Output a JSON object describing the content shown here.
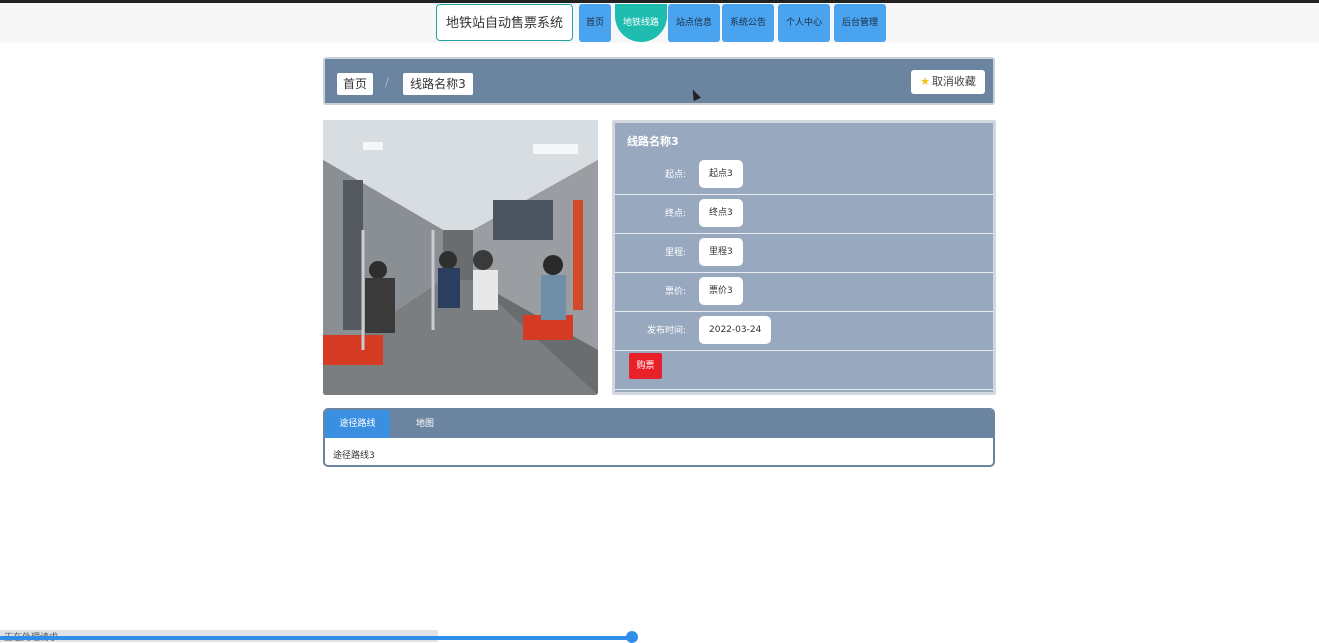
{
  "nav": {
    "brand": "地铁站自动售票系统",
    "items": [
      {
        "label": "首页"
      },
      {
        "label": "地铁线路"
      },
      {
        "label": "站点信息"
      },
      {
        "label": "系统公告"
      },
      {
        "label": "个人中心"
      },
      {
        "label": "后台管理"
      }
    ],
    "active_index": 1
  },
  "breadcrumb": {
    "home": "首页",
    "separator": "/",
    "current": "线路名称3",
    "favorite_button": "取消收藏"
  },
  "detail": {
    "title": "线路名称3",
    "fields": [
      {
        "label": "起点:",
        "value": "起点3"
      },
      {
        "label": "终点:",
        "value": "终点3"
      },
      {
        "label": "里程:",
        "value": "里程3"
      },
      {
        "label": "票价:",
        "value": "票价3"
      },
      {
        "label": "发布时间:",
        "value": "2022-03-24"
      }
    ],
    "buy_button": "购票"
  },
  "tabs": {
    "items": [
      {
        "label": "途径路线"
      },
      {
        "label": "地图"
      }
    ],
    "active_index": 0,
    "content": "途径路线3"
  },
  "status": {
    "text": "正在处理请求"
  },
  "colors": {
    "nav_button": "#4aa3ee",
    "nav_active": "#1fbcb0",
    "panel": "#6b85a0",
    "detail_bg": "#98a9bf",
    "buy": "#e8202a"
  },
  "icons": {
    "favorite": "star-icon"
  }
}
